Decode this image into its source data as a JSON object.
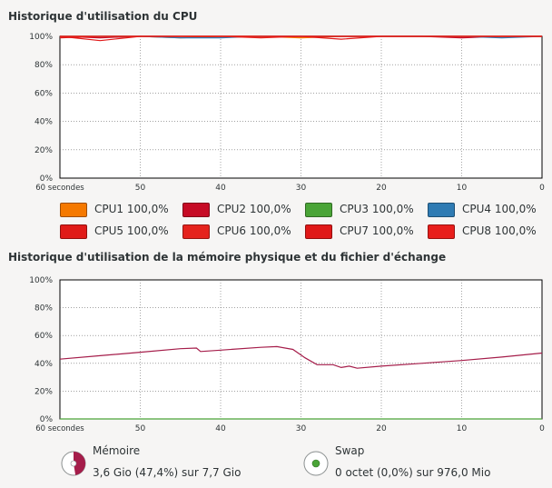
{
  "cpu": {
    "title": "Historique d'utilisation du CPU",
    "y_ticks": [
      "100%",
      "80%",
      "60%",
      "40%",
      "20%",
      "0%"
    ],
    "x_ticks": [
      "60 secondes",
      "50",
      "40",
      "30",
      "20",
      "10",
      "0"
    ],
    "legend": [
      {
        "label": "CPU1",
        "value": "100,0%",
        "color": "#f57900"
      },
      {
        "label": "CPU2",
        "value": "100,0%",
        "color": "#c60b25"
      },
      {
        "label": "CPU3",
        "value": "100,0%",
        "color": "#4aa437"
      },
      {
        "label": "CPU4",
        "value": "100,0%",
        "color": "#2f7bb3"
      },
      {
        "label": "CPU5",
        "value": "100,0%",
        "color": "#e01b18"
      },
      {
        "label": "CPU6",
        "value": "100,0%",
        "color": "#e5231d"
      },
      {
        "label": "CPU7",
        "value": "100,0%",
        "color": "#e01818"
      },
      {
        "label": "CPU8",
        "value": "100,0%",
        "color": "#e81e1b"
      }
    ]
  },
  "memory": {
    "title": "Historique d'utilisation de la mémoire physique et du fichier d'échange",
    "y_ticks": [
      "100%",
      "80%",
      "60%",
      "40%",
      "20%",
      "0%"
    ],
    "x_ticks": [
      "60 secondes",
      "50",
      "40",
      "30",
      "20",
      "10",
      "0"
    ],
    "memory_label": "Mémoire",
    "memory_value": "3,6 Gio (47,4%) sur 7,7 Gio",
    "memory_fraction": 0.474,
    "memory_color": "#a51d4a",
    "swap_label": "Swap",
    "swap_value": "0 octet (0,0%) sur 976,0 Mio",
    "swap_fraction": 0.0,
    "swap_color": "#4aa437"
  },
  "chart_data": [
    {
      "type": "line",
      "title": "Historique d'utilisation du CPU",
      "xlabel": "",
      "ylabel": "",
      "x_range": [
        60,
        0
      ],
      "ylim": [
        0,
        100
      ],
      "grid": true,
      "series": [
        {
          "name": "CPU1",
          "x": [
            60,
            55,
            50,
            45,
            40,
            35,
            30,
            25,
            20,
            15,
            10,
            5,
            0
          ],
          "values": [
            100,
            100,
            100,
            99,
            100,
            100,
            99,
            100,
            100,
            100,
            100,
            100,
            100
          ]
        },
        {
          "name": "CPU2",
          "x": [
            60,
            55,
            50,
            45,
            40,
            35,
            30,
            25,
            20,
            15,
            10,
            5,
            0
          ],
          "values": [
            100,
            99,
            100,
            100,
            100,
            100,
            100,
            100,
            100,
            100,
            99,
            100,
            100
          ]
        },
        {
          "name": "CPU3",
          "x": [
            60,
            55,
            50,
            45,
            40,
            35,
            30,
            25,
            20,
            15,
            10,
            5,
            0
          ],
          "values": [
            100,
            100,
            100,
            100,
            100,
            100,
            100,
            100,
            100,
            100,
            100,
            100,
            100
          ]
        },
        {
          "name": "CPU4",
          "x": [
            60,
            55,
            50,
            45,
            40,
            35,
            30,
            25,
            20,
            15,
            10,
            5,
            0
          ],
          "values": [
            100,
            100,
            100,
            99,
            99,
            100,
            100,
            100,
            100,
            100,
            100,
            99,
            100
          ]
        },
        {
          "name": "CPU5",
          "x": [
            60,
            55,
            50,
            45,
            40,
            35,
            30,
            25,
            20,
            15,
            10,
            5,
            0
          ],
          "values": [
            99,
            100,
            100,
            100,
            100,
            100,
            100,
            100,
            100,
            100,
            100,
            100,
            100
          ]
        },
        {
          "name": "CPU6",
          "x": [
            60,
            55,
            50,
            45,
            40,
            35,
            30,
            25,
            20,
            15,
            10,
            5,
            0
          ],
          "values": [
            100,
            100,
            100,
            100,
            100,
            99,
            100,
            100,
            100,
            100,
            100,
            100,
            100
          ]
        },
        {
          "name": "CPU7",
          "x": [
            60,
            55,
            50,
            45,
            40,
            35,
            30,
            25,
            20,
            15,
            10,
            5,
            0
          ],
          "values": [
            100,
            97,
            100,
            100,
            100,
            100,
            100,
            98,
            100,
            100,
            100,
            100,
            100
          ]
        },
        {
          "name": "CPU8",
          "x": [
            60,
            55,
            50,
            45,
            40,
            35,
            30,
            25,
            20,
            15,
            10,
            5,
            0
          ],
          "values": [
            100,
            100,
            100,
            100,
            100,
            100,
            100,
            100,
            100,
            100,
            100,
            100,
            100
          ]
        }
      ]
    },
    {
      "type": "line",
      "title": "Historique d'utilisation de la mémoire physique et du fichier d'échange",
      "xlabel": "",
      "ylabel": "",
      "x_range": [
        60,
        0
      ],
      "ylim": [
        0,
        100
      ],
      "grid": true,
      "series": [
        {
          "name": "Mémoire",
          "x": [
            60,
            55,
            50,
            45,
            43,
            42.5,
            40,
            35,
            33,
            31,
            30,
            29.5,
            28,
            26,
            25,
            24,
            23,
            20,
            15,
            10,
            5,
            0
          ],
          "values": [
            43,
            45.5,
            48,
            50.5,
            51,
            48.5,
            49.5,
            51.5,
            52,
            50,
            46,
            44,
            39,
            39,
            37,
            38,
            36.5,
            38,
            40,
            42,
            44.5,
            47.4
          ]
        },
        {
          "name": "Swap",
          "x": [
            60,
            0
          ],
          "values": [
            0,
            0
          ]
        }
      ]
    }
  ]
}
